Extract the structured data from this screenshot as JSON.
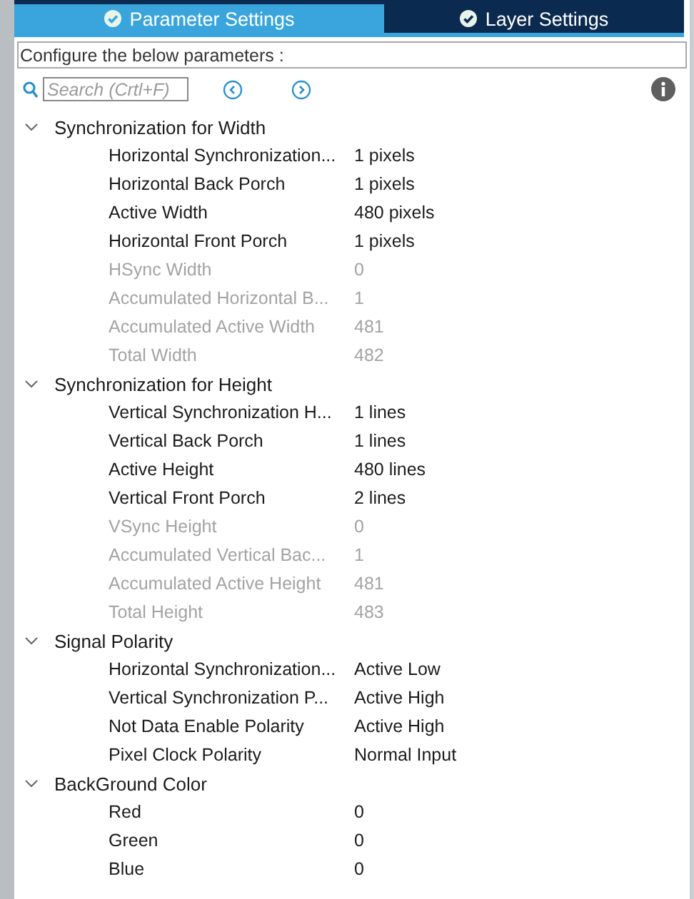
{
  "tabs": [
    {
      "label": "Parameter Settings",
      "selected": true
    },
    {
      "label": "Layer Settings",
      "selected": false
    }
  ],
  "caption": "Configure the below parameters :",
  "search": {
    "placeholder": "Search (Crtl+F)"
  },
  "groups": [
    {
      "title": "Synchronization for Width",
      "expanded": true,
      "rows": [
        {
          "name": "Horizontal Synchronization...",
          "value": "1 pixels",
          "disabled": false
        },
        {
          "name": "Horizontal Back Porch",
          "value": "1 pixels",
          "disabled": false
        },
        {
          "name": "Active Width",
          "value": "480 pixels",
          "disabled": false
        },
        {
          "name": "Horizontal Front Porch",
          "value": "1 pixels",
          "disabled": false
        },
        {
          "name": "HSync Width",
          "value": "0",
          "disabled": true
        },
        {
          "name": "Accumulated Horizontal B...",
          "value": "1",
          "disabled": true
        },
        {
          "name": "Accumulated Active Width",
          "value": "481",
          "disabled": true
        },
        {
          "name": "Total Width",
          "value": "482",
          "disabled": true
        }
      ]
    },
    {
      "title": "Synchronization for Height",
      "expanded": true,
      "rows": [
        {
          "name": "Vertical Synchronization H...",
          "value": "1 lines",
          "disabled": false
        },
        {
          "name": "Vertical Back Porch",
          "value": "1 lines",
          "disabled": false
        },
        {
          "name": "Active Height",
          "value": "480 lines",
          "disabled": false
        },
        {
          "name": "Vertical Front Porch",
          "value": "2 lines",
          "disabled": false
        },
        {
          "name": "VSync Height",
          "value": "0",
          "disabled": true
        },
        {
          "name": "Accumulated Vertical Bac...",
          "value": "1",
          "disabled": true
        },
        {
          "name": "Accumulated Active Height",
          "value": "481",
          "disabled": true
        },
        {
          "name": "Total Height",
          "value": "483",
          "disabled": true
        }
      ]
    },
    {
      "title": "Signal Polarity",
      "expanded": true,
      "rows": [
        {
          "name": "Horizontal Synchronization...",
          "value": "Active Low",
          "disabled": false
        },
        {
          "name": "Vertical Synchronization P...",
          "value": "Active High",
          "disabled": false
        },
        {
          "name": "Not Data Enable Polarity",
          "value": "Active High",
          "disabled": false
        },
        {
          "name": "Pixel Clock Polarity",
          "value": "Normal Input",
          "disabled": false
        }
      ]
    },
    {
      "title": "BackGround Color",
      "expanded": true,
      "rows": [
        {
          "name": "Red",
          "value": "0",
          "disabled": false
        },
        {
          "name": "Green",
          "value": "0",
          "disabled": false
        },
        {
          "name": "Blue",
          "value": "0",
          "disabled": false
        }
      ]
    }
  ]
}
